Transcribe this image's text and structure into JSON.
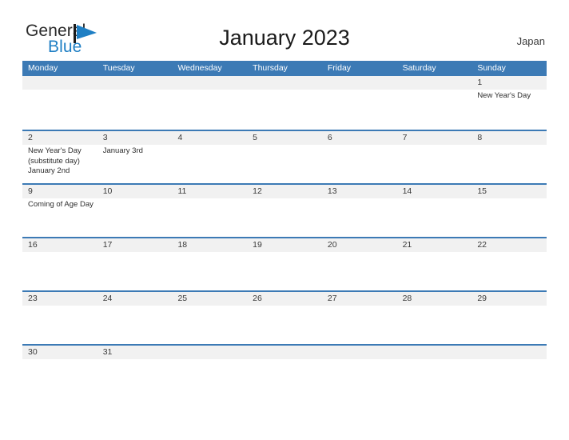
{
  "brand": {
    "word1": "General",
    "word2": "Blue",
    "flag_icon": "flag-triangle-icon",
    "accent_color": "#1f7fc4"
  },
  "header": {
    "title": "January 2023",
    "country": "Japan"
  },
  "theme": {
    "header_blue": "#3c7ab5",
    "daynum_band": "#f1f1f1",
    "rule_blue": "#3c7ab5",
    "text_dark": "#2e2e2e"
  },
  "calendar": {
    "weekdays": [
      "Monday",
      "Tuesday",
      "Wednesday",
      "Thursday",
      "Friday",
      "Saturday",
      "Sunday"
    ],
    "weeks": [
      {
        "days": [
          {
            "num": "",
            "events": []
          },
          {
            "num": "",
            "events": []
          },
          {
            "num": "",
            "events": []
          },
          {
            "num": "",
            "events": []
          },
          {
            "num": "",
            "events": []
          },
          {
            "num": "",
            "events": []
          },
          {
            "num": "1",
            "events": [
              "New Year's Day"
            ]
          }
        ]
      },
      {
        "days": [
          {
            "num": "2",
            "events": [
              "New Year's Day (substitute day) January 2nd"
            ]
          },
          {
            "num": "3",
            "events": [
              "January 3rd"
            ]
          },
          {
            "num": "4",
            "events": []
          },
          {
            "num": "5",
            "events": []
          },
          {
            "num": "6",
            "events": []
          },
          {
            "num": "7",
            "events": []
          },
          {
            "num": "8",
            "events": []
          }
        ]
      },
      {
        "days": [
          {
            "num": "9",
            "events": [
              "Coming of Age Day"
            ]
          },
          {
            "num": "10",
            "events": []
          },
          {
            "num": "11",
            "events": []
          },
          {
            "num": "12",
            "events": []
          },
          {
            "num": "13",
            "events": []
          },
          {
            "num": "14",
            "events": []
          },
          {
            "num": "15",
            "events": []
          }
        ]
      },
      {
        "days": [
          {
            "num": "16",
            "events": []
          },
          {
            "num": "17",
            "events": []
          },
          {
            "num": "18",
            "events": []
          },
          {
            "num": "19",
            "events": []
          },
          {
            "num": "20",
            "events": []
          },
          {
            "num": "21",
            "events": []
          },
          {
            "num": "22",
            "events": []
          }
        ]
      },
      {
        "days": [
          {
            "num": "23",
            "events": []
          },
          {
            "num": "24",
            "events": []
          },
          {
            "num": "25",
            "events": []
          },
          {
            "num": "26",
            "events": []
          },
          {
            "num": "27",
            "events": []
          },
          {
            "num": "28",
            "events": []
          },
          {
            "num": "29",
            "events": []
          }
        ]
      },
      {
        "days": [
          {
            "num": "30",
            "events": []
          },
          {
            "num": "31",
            "events": []
          },
          {
            "num": "",
            "events": []
          },
          {
            "num": "",
            "events": []
          },
          {
            "num": "",
            "events": []
          },
          {
            "num": "",
            "events": []
          },
          {
            "num": "",
            "events": []
          }
        ]
      }
    ]
  }
}
